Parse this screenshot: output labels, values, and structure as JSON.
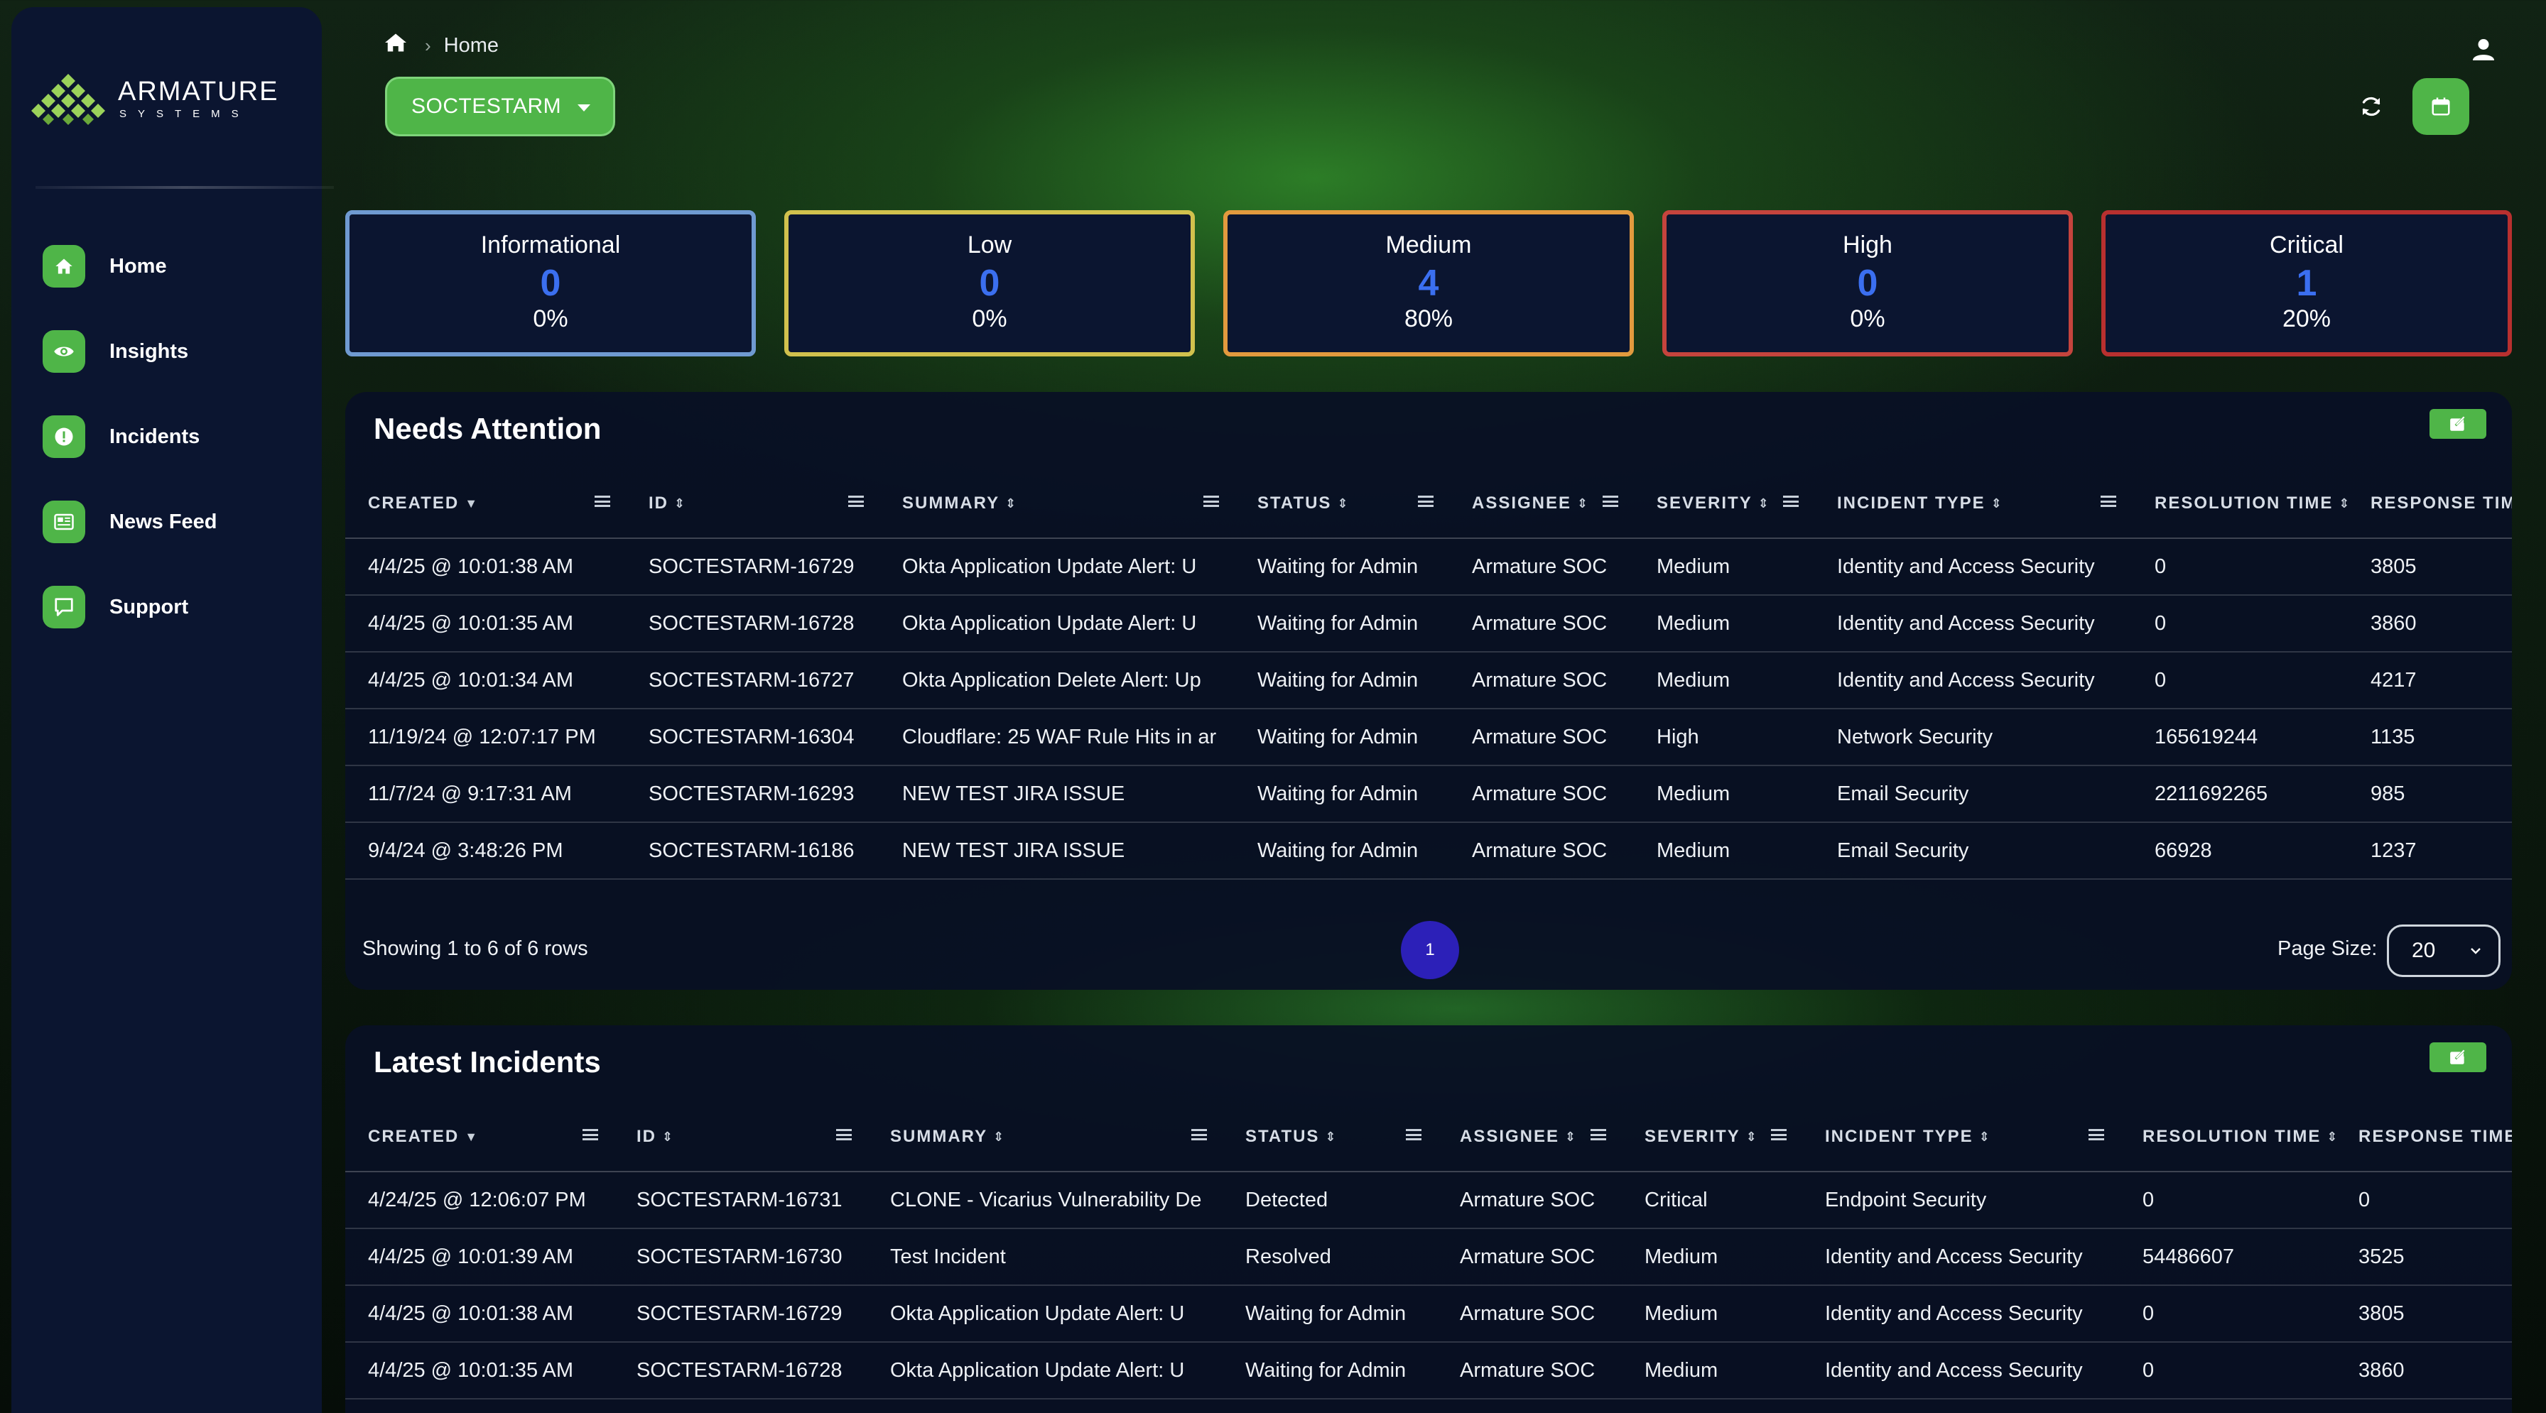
{
  "brand": {
    "name": "ARMATURE",
    "subtitle": "SYSTEMS"
  },
  "sidebar": {
    "items": [
      {
        "label": "Home",
        "icon": "home-icon"
      },
      {
        "label": "Insights",
        "icon": "eye-icon"
      },
      {
        "label": "Incidents",
        "icon": "alert-icon"
      },
      {
        "label": "News Feed",
        "icon": "newspaper-icon"
      },
      {
        "label": "Support",
        "icon": "chat-icon"
      }
    ]
  },
  "header": {
    "breadcrumb": {
      "home_icon": "home-icon",
      "current": "Home"
    },
    "org_select": {
      "value": "SOCTESTARM"
    },
    "icons": {
      "user": "user-icon",
      "refresh": "refresh-icon",
      "calendar": "calendar-icon"
    }
  },
  "severity_cards": [
    {
      "label": "Informational",
      "count": "0",
      "pct": "0%",
      "color": "#6f9ad1"
    },
    {
      "label": "Low",
      "count": "0",
      "pct": "0%",
      "color": "#d1c14d"
    },
    {
      "label": "Medium",
      "count": "4",
      "pct": "80%",
      "color": "#e29a3e"
    },
    {
      "label": "High",
      "count": "0",
      "pct": "0%",
      "color": "#c5443d"
    },
    {
      "label": "Critical",
      "count": "1",
      "pct": "20%",
      "color": "#b8302f"
    }
  ],
  "colors": {
    "accent_green": "#4fb548",
    "id_link": "#4fb548",
    "page_active": "#2c20b8",
    "count_blue": "#3b6ff0",
    "sidebar_bg": "#0b1530"
  },
  "needs_attention": {
    "title": "Needs Attention",
    "columns": [
      "CREATED",
      "ID",
      "SUMMARY",
      "STATUS",
      "ASSIGNEE",
      "SEVERITY",
      "INCIDENT TYPE",
      "RESOLUTION TIME",
      "RESPONSE TIM"
    ],
    "rows": [
      [
        "4/4/25 @ 10:01:38 AM",
        "SOCTESTARM-16729",
        "Okta Application Update Alert: U",
        "Waiting for Admin",
        "Armature SOC",
        "Medium",
        "Identity and Access Security",
        "0",
        "3805"
      ],
      [
        "4/4/25 @ 10:01:35 AM",
        "SOCTESTARM-16728",
        "Okta Application Update Alert: U",
        "Waiting for Admin",
        "Armature SOC",
        "Medium",
        "Identity and Access Security",
        "0",
        "3860"
      ],
      [
        "4/4/25 @ 10:01:34 AM",
        "SOCTESTARM-16727",
        "Okta Application Delete Alert: Up",
        "Waiting for Admin",
        "Armature SOC",
        "Medium",
        "Identity and Access Security",
        "0",
        "4217"
      ],
      [
        "11/19/24 @ 12:07:17 PM",
        "SOCTESTARM-16304",
        "Cloudflare: 25 WAF Rule Hits in ar",
        "Waiting for Admin",
        "Armature SOC",
        "High",
        "Network Security",
        "165619244",
        "1135"
      ],
      [
        "11/7/24 @ 9:17:31 AM",
        "SOCTESTARM-16293",
        "NEW TEST JIRA ISSUE",
        "Waiting for Admin",
        "Armature SOC",
        "Medium",
        "Email Security",
        "2211692265",
        "985"
      ],
      [
        "9/4/24 @ 3:48:26 PM",
        "SOCTESTARM-16186",
        "NEW TEST JIRA ISSUE",
        "Waiting for Admin",
        "Armature SOC",
        "Medium",
        "Email Security",
        "66928",
        "1237"
      ]
    ],
    "pagination": {
      "info": "Showing 1 to 6 of 6 rows",
      "current_page": "1",
      "page_size_label": "Page Size:",
      "page_size": "20"
    }
  },
  "latest_incidents": {
    "title": "Latest Incidents",
    "columns": [
      "CREATED",
      "ID",
      "SUMMARY",
      "STATUS",
      "ASSIGNEE",
      "SEVERITY",
      "INCIDENT TYPE",
      "RESOLUTION TIME",
      "RESPONSE TIME"
    ],
    "rows": [
      [
        "4/24/25 @ 12:06:07 PM",
        "SOCTESTARM-16731",
        "CLONE - Vicarius Vulnerability De",
        "Detected",
        "Armature SOC",
        "Critical",
        "Endpoint Security",
        "0",
        "0"
      ],
      [
        "4/4/25 @ 10:01:39 AM",
        "SOCTESTARM-16730",
        "Test Incident",
        "Resolved",
        "Armature SOC",
        "Medium",
        "Identity and Access Security",
        "54486607",
        "3525"
      ],
      [
        "4/4/25 @ 10:01:38 AM",
        "SOCTESTARM-16729",
        "Okta Application Update Alert: U",
        "Waiting for Admin",
        "Armature SOC",
        "Medium",
        "Identity and Access Security",
        "0",
        "3805"
      ],
      [
        "4/4/25 @ 10:01:35 AM",
        "SOCTESTARM-16728",
        "Okta Application Update Alert: U",
        "Waiting for Admin",
        "Armature SOC",
        "Medium",
        "Identity and Access Security",
        "0",
        "3860"
      ]
    ]
  }
}
